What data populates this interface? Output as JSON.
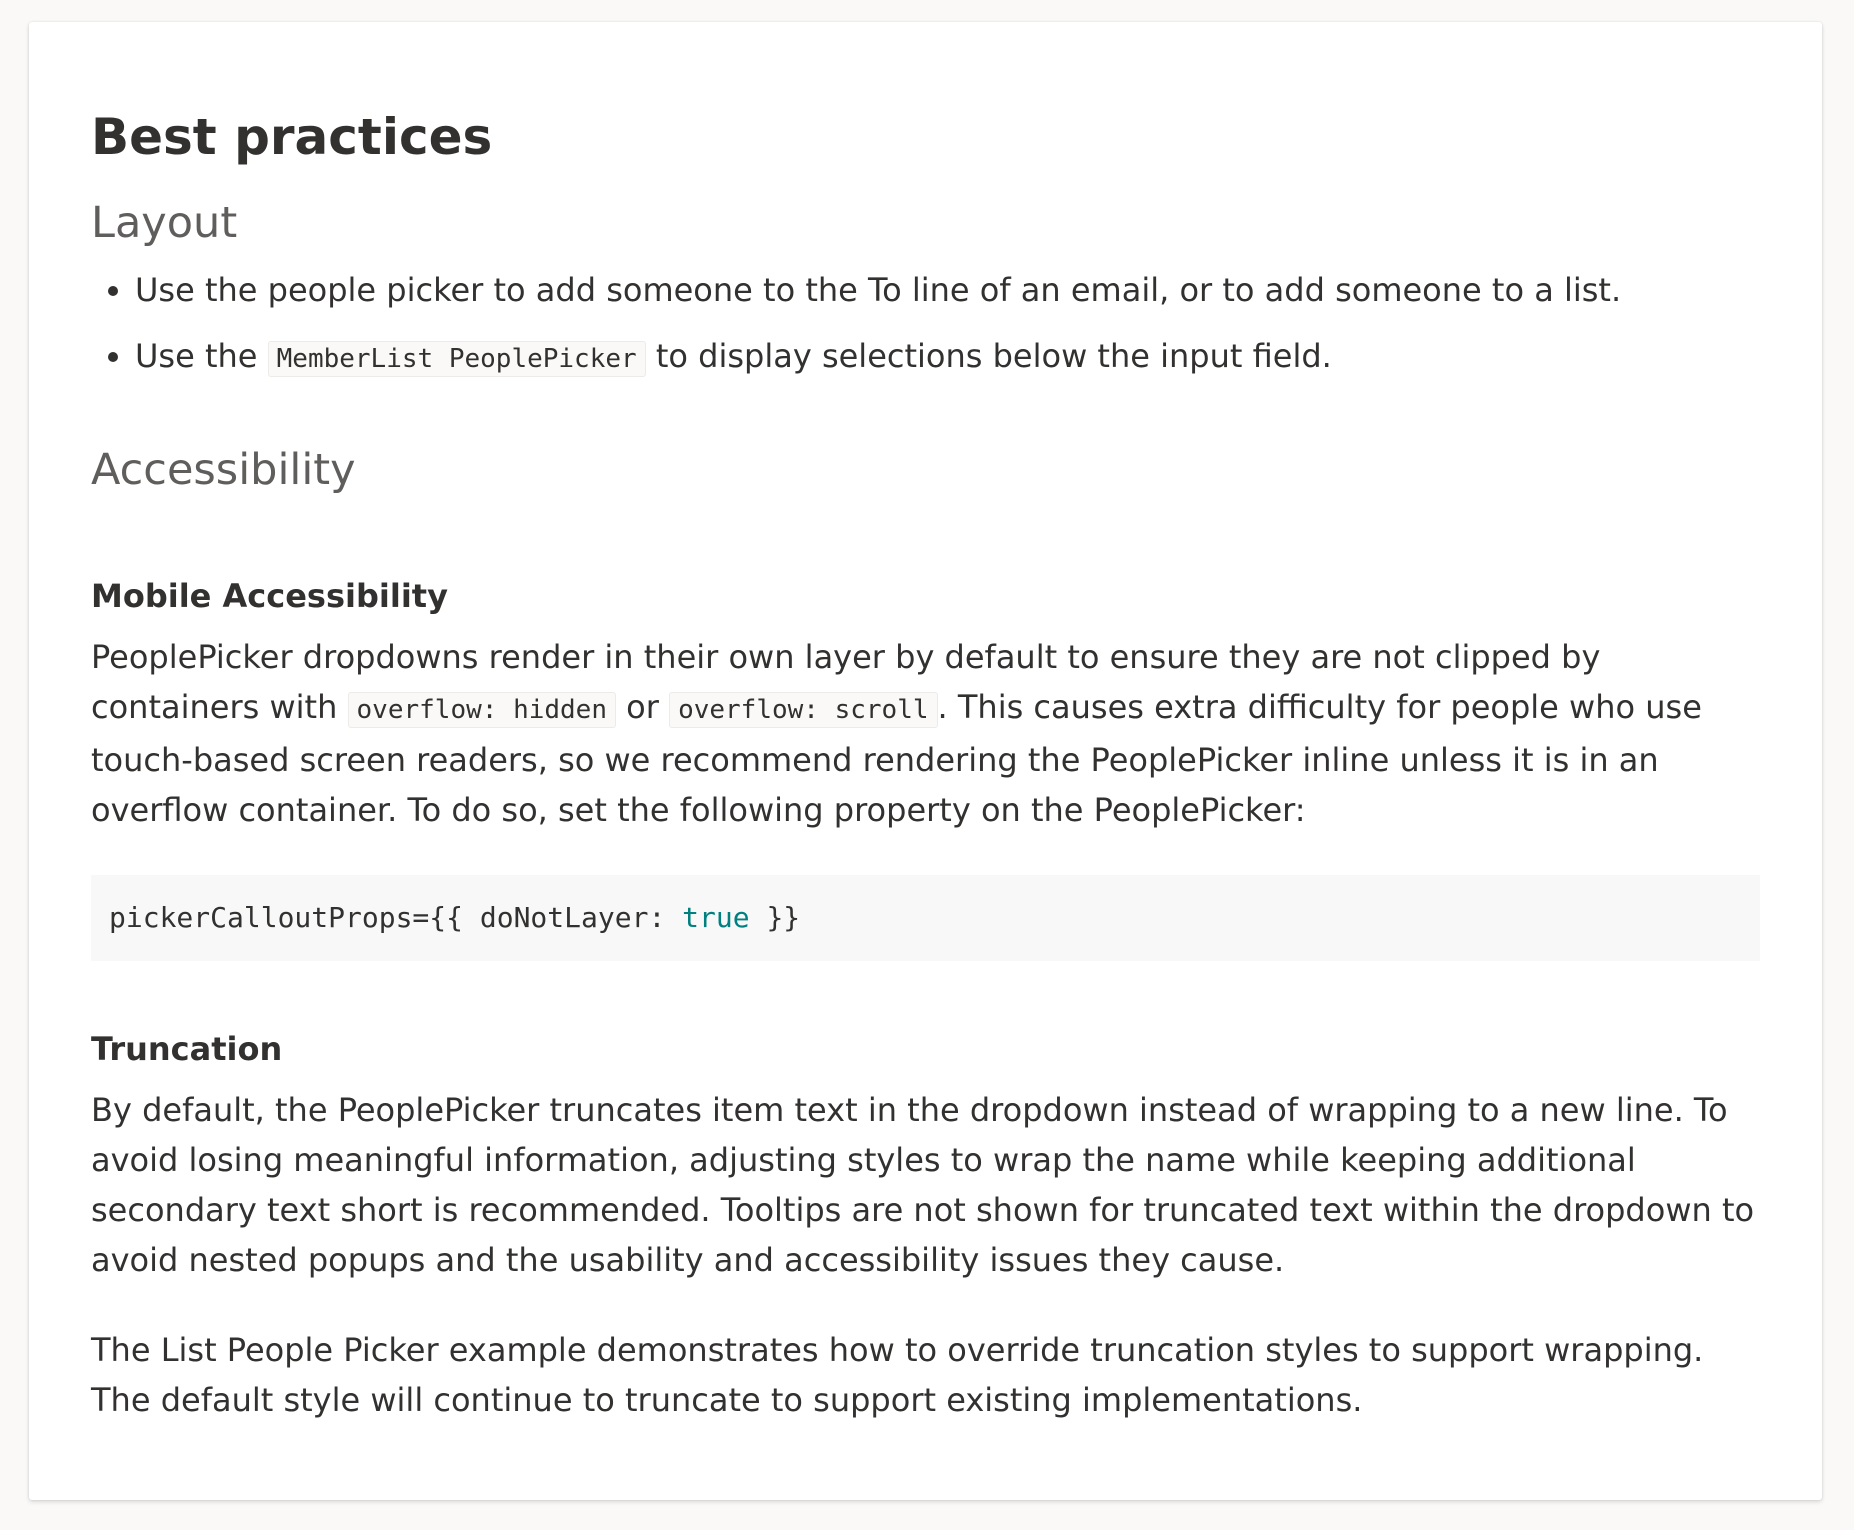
{
  "page_title": "Best practices",
  "layout": {
    "heading": "Layout",
    "bullets": [
      {
        "text": "Use the people picker to add someone to the To line of an email, or to add someone to a list."
      },
      {
        "prefix": "Use the ",
        "code": "MemberList PeoplePicker",
        "suffix": " to display selections below the input field."
      }
    ]
  },
  "accessibility": {
    "heading": "Accessibility",
    "mobile": {
      "heading": "Mobile Accessibility",
      "p1_a": "PeoplePicker dropdowns render in their own layer by default to ensure they are not clipped by containers with ",
      "p1_code1": "overflow: hidden",
      "p1_b": " or ",
      "p1_code2": "overflow: scroll",
      "p1_c": ". This causes extra difficulty for people who use touch-based screen readers, so we recommend rendering the PeoplePicker inline unless it is in an overflow container. To do so, set the following property on the PeoplePicker:",
      "code_before": "pickerCalloutProps={{ doNotLayer: ",
      "code_keyword": "true",
      "code_after": " }}",
      "keyword_color": "#008080"
    },
    "truncation": {
      "heading": "Truncation",
      "p1": "By default, the PeoplePicker truncates item text in the dropdown instead of wrapping to a new line. To avoid losing meaningful information, adjusting styles to wrap the name while keeping additional secondary text short is recommended. Tooltips are not shown for truncated text within the dropdown to avoid nested popups and the usability and accessibility issues they cause.",
      "p2": "The List People Picker example demonstrates how to override truncation styles to support wrapping. The default style will continue to truncate to support existing implementations."
    }
  }
}
